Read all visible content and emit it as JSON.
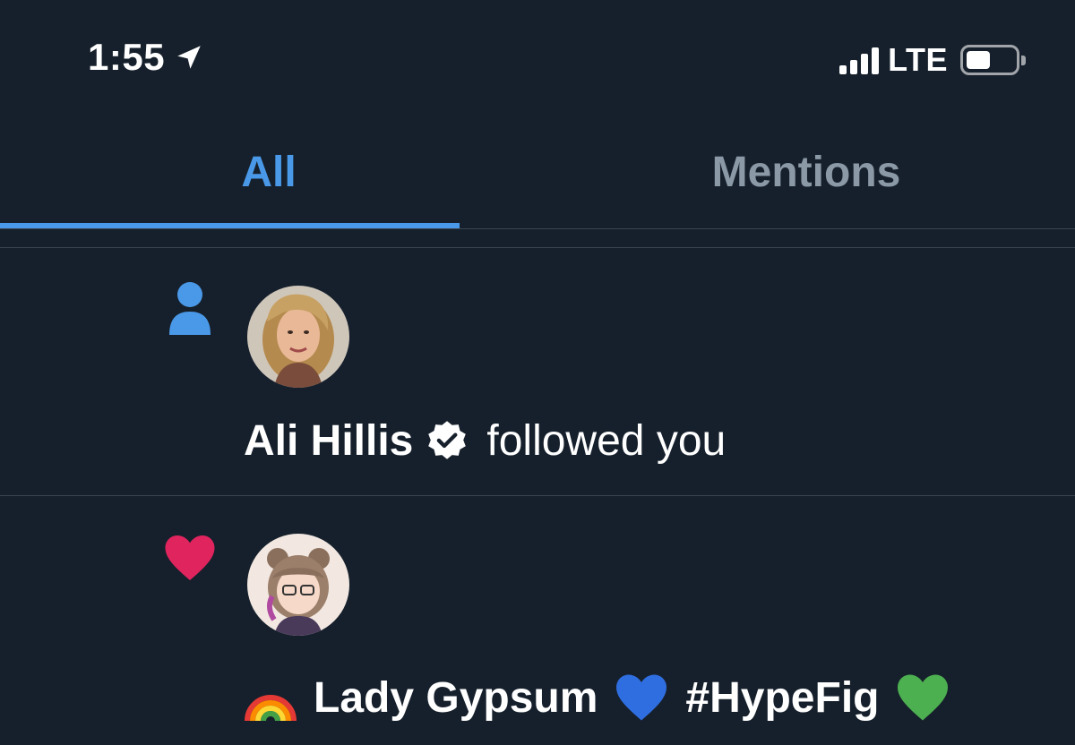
{
  "status_bar": {
    "time": "1:55",
    "carrier": "LTE",
    "battery_level": 0.45
  },
  "tabs": [
    {
      "label": "All",
      "active": true
    },
    {
      "label": "Mentions",
      "active": false
    }
  ],
  "notifications": [
    {
      "type": "follow",
      "icon": "person-icon",
      "name": "Ali Hillis",
      "verified": true,
      "action": "followed you",
      "icon_color": "#4a99e9"
    },
    {
      "type": "like",
      "icon": "heart-icon",
      "name": "Lady Gypsum",
      "hashtag": "#HypeFig",
      "icon_color": "#e0245e"
    }
  ],
  "colors": {
    "background": "#16202c",
    "accent": "#4a99e9",
    "muted": "#8b98a5",
    "like": "#e0245e"
  }
}
